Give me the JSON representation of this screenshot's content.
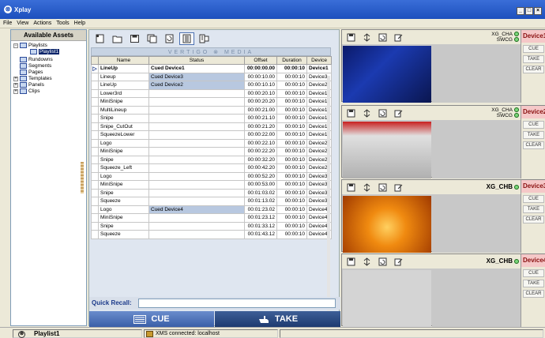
{
  "app": {
    "title": "Xplay",
    "min": "_",
    "max": "□",
    "close": "×"
  },
  "menu": [
    "File",
    "View",
    "Actions",
    "Tools",
    "Help"
  ],
  "assets": {
    "header": "Available Assets",
    "tree": [
      {
        "label": "Playlists",
        "expander": "−",
        "level": 0
      },
      {
        "label": "Playlist1",
        "level": 1,
        "selected": true
      },
      {
        "label": "Rundowns",
        "level": 0
      },
      {
        "label": "Segments",
        "level": 0
      },
      {
        "label": "Pages",
        "level": 0
      },
      {
        "label": "Templates",
        "expander": "+",
        "level": 0
      },
      {
        "label": "Panels",
        "expander": "+",
        "level": 0
      },
      {
        "label": "Clips",
        "expander": "+",
        "level": 0
      }
    ]
  },
  "playlist": {
    "brand": "VERTIGO ⊗ MEDIA",
    "columns": [
      "Name",
      "Status",
      "Offset",
      "Duration",
      "Device"
    ],
    "rows": [
      {
        "name": "LineUp",
        "status": "Cued Device1",
        "offset": "00:00:00.00",
        "duration": "00:00:10",
        "device": "Device1",
        "bold": true,
        "indicator": "▷"
      },
      {
        "name": "Lineup",
        "status": "Cued Device3",
        "offset": "00:00:10.00",
        "duration": "00:00:10",
        "device": "Device3",
        "cued": true
      },
      {
        "name": "LineUp",
        "status": "Cued Device2",
        "offset": "00:00:10.10",
        "duration": "00:00:10",
        "device": "Device2",
        "cued": true
      },
      {
        "name": "Lower3rd",
        "status": "",
        "offset": "00:00:20.10",
        "duration": "00:00:10",
        "device": "Device1"
      },
      {
        "name": "MiniSnipe",
        "status": "",
        "offset": "00:00:20.20",
        "duration": "00:00:10",
        "device": "Device1"
      },
      {
        "name": "MultiLineup",
        "status": "",
        "offset": "00:00:21.00",
        "duration": "00:00:10",
        "device": "Device1"
      },
      {
        "name": "Snipe",
        "status": "",
        "offset": "00:00:21.10",
        "duration": "00:00:10",
        "device": "Device1"
      },
      {
        "name": "Snipe_CutOut",
        "status": "",
        "offset": "00:00:21.20",
        "duration": "00:00:10",
        "device": "Device1"
      },
      {
        "name": "SqueezeLower",
        "status": "",
        "offset": "00:00:22.00",
        "duration": "00:00:10",
        "device": "Device1"
      },
      {
        "name": "Logo",
        "status": "",
        "offset": "00:00:22.10",
        "duration": "00:00:10",
        "device": "Device2"
      },
      {
        "name": "MiniSnipe",
        "status": "",
        "offset": "00:00:22.20",
        "duration": "00:00:10",
        "device": "Device2"
      },
      {
        "name": "Snipe",
        "status": "",
        "offset": "00:00:32.20",
        "duration": "00:00:10",
        "device": "Device2"
      },
      {
        "name": "Squeeze_Left",
        "status": "",
        "offset": "00:00:42.20",
        "duration": "00:00:10",
        "device": "Device2"
      },
      {
        "name": "Logo",
        "status": "",
        "offset": "00:00:52.20",
        "duration": "00:00:10",
        "device": "Device3"
      },
      {
        "name": "MiniSnipe",
        "status": "",
        "offset": "00:00:53.00",
        "duration": "00:00:10",
        "device": "Device3"
      },
      {
        "name": "Snipe",
        "status": "",
        "offset": "00:01:03.02",
        "duration": "00:00:10",
        "device": "Device3"
      },
      {
        "name": "Squeeze",
        "status": "",
        "offset": "00:01:13.02",
        "duration": "00:00:10",
        "device": "Device3"
      },
      {
        "name": "Logo",
        "status": "Cued Device4",
        "offset": "00:01:23.02",
        "duration": "00:00:10",
        "device": "Device4",
        "cued": true
      },
      {
        "name": "MiniSnipe",
        "status": "",
        "offset": "00:01:23.12",
        "duration": "00:00:10",
        "device": "Device4"
      },
      {
        "name": "Snipe",
        "status": "",
        "offset": "00:01:33.12",
        "duration": "00:00:10",
        "device": "Device4"
      },
      {
        "name": "Squeeze",
        "status": "",
        "offset": "00:01:43.12",
        "duration": "00:00:10",
        "device": "Device4"
      }
    ],
    "quick_recall_label": "Quick Recall:",
    "cue_label": "CUE",
    "take_label": "TAKE"
  },
  "devices": [
    {
      "name": "Device1",
      "channel1": "XG_CHA",
      "channel2": "SWCG",
      "preview": "blue"
    },
    {
      "name": "Device2",
      "channel1": "XG_CHA",
      "channel2": "SWCG",
      "preview": "red"
    },
    {
      "name": "Device3",
      "channel1": "XG_CHB",
      "channel2": "",
      "preview": "orange"
    },
    {
      "name": "Device4",
      "channel1": "XG_CHB",
      "channel2": "",
      "preview": "empty"
    }
  ],
  "device_buttons": {
    "cue": "CUE",
    "take": "TAKE",
    "clear": "CLEAR"
  },
  "status": {
    "playlist": "Playlist1",
    "connection": "XMS connected: localhost"
  },
  "colors": {
    "title_bar": "#1c4fbd",
    "take_button": "#1e3a70",
    "cue_button": "#3a5fa8",
    "device_label_bg": "#f5c8c8",
    "led_green": "#7ad67a"
  }
}
